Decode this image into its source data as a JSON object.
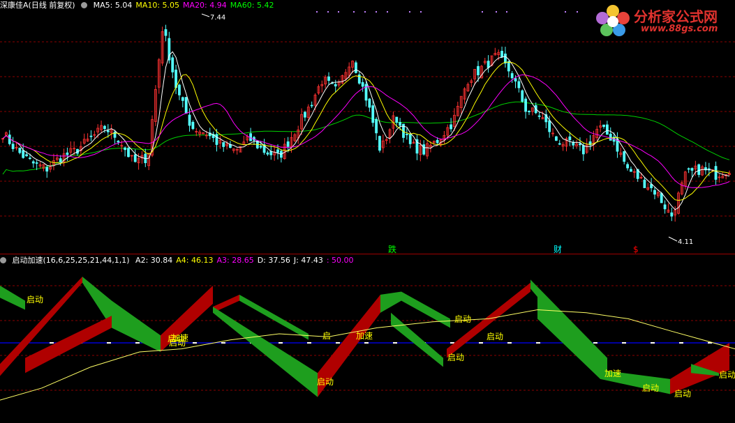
{
  "header_main": {
    "title": "深康佳A(日线 前复权)",
    "indicators": [
      {
        "label": "MA5: 5.04",
        "color": "#ffffff"
      },
      {
        "label": "MA10: 5.05",
        "color": "#ffff00"
      },
      {
        "label": "MA20: 4.94",
        "color": "#ff00ff"
      },
      {
        "label": "MA60: 5.42",
        "color": "#00ff00"
      }
    ]
  },
  "header_sub": {
    "title": "启动加速(16,6,25,25,21,44,1,1)",
    "indicators": [
      {
        "label": "A2: 30.84",
        "color": "#ffffff"
      },
      {
        "label": "A4: 46.13",
        "color": "#ffff00"
      },
      {
        "label": "A3: 28.65",
        "color": "#ff00ff"
      },
      {
        "label": "D: 37.56",
        "color": "#ffffff"
      },
      {
        "label": "J: 47.43",
        "color": "#ffffff"
      },
      {
        "label": ": 50.00",
        "color": "#ff00ff"
      }
    ]
  },
  "logo": {
    "title": "分析家公式网",
    "url": "www.88gs.com"
  },
  "colors": {
    "up": "#ff3232",
    "down": "#54ffff",
    "ma5": "#ffffff",
    "ma10": "#ffff00",
    "ma20": "#ff00ff",
    "ma60": "#00d000",
    "grid": "#8b0000",
    "ribbon_red": "#b00000",
    "ribbon_green": "#1e9e1e",
    "signal_line": "#ffff66",
    "baseline": "#0000ff"
  },
  "chart_data": [
    {
      "type": "candlestick",
      "price_range": [
        3.8,
        7.6
      ],
      "annotations": [
        {
          "text": "7.44",
          "kind": "high"
        },
        {
          "text": "4.11",
          "kind": "low"
        }
      ],
      "event_markers": [
        {
          "text": "跌",
          "color": "#00ff00"
        },
        {
          "text": "财",
          "color": "#00ffff"
        },
        {
          "text": "$",
          "color": "#ff0000"
        }
      ],
      "key_prices": [
        5.6,
        5.3,
        5.1,
        5.0,
        5.2,
        5.3,
        5.5,
        5.7,
        5.5,
        5.1,
        5.2,
        7.4,
        6.3,
        5.7,
        5.6,
        5.4,
        5.3,
        5.5,
        5.3,
        5.2,
        5.6,
        6.0,
        6.5,
        6.3,
        6.9,
        6.2,
        5.3,
        5.9,
        5.4,
        5.3,
        5.5,
        5.8,
        6.5,
        6.7,
        6.9,
        6.6,
        6.0,
        5.9,
        5.5,
        5.4,
        5.3,
        5.7,
        5.5,
        5.0,
        4.8,
        4.6,
        4.2,
        4.9,
        5.0,
        4.9,
        5.0
      ]
    },
    {
      "type": "area",
      "name": "启动加速",
      "range": [
        0,
        100
      ],
      "labels": [
        {
          "text": "启动",
          "color": "#ffff00"
        },
        {
          "text": "启动",
          "color": "#ffff00"
        },
        {
          "text": "加速",
          "color": "#ffff00"
        },
        {
          "text": "启",
          "color": "#ffff00"
        },
        {
          "text": "加速",
          "color": "#ffff00"
        },
        {
          "text": "启动",
          "color": "#ffff00"
        },
        {
          "text": "启动",
          "color": "#ffff00"
        },
        {
          "text": "启动",
          "color": "#ffff00"
        },
        {
          "text": "启动",
          "color": "#ffff00"
        },
        {
          "text": "加速",
          "color": "#ffff00"
        },
        {
          "text": "启动",
          "color": "#ffff00"
        },
        {
          "text": "启动",
          "color": "#ffff00"
        },
        {
          "text": "启动",
          "color": "#ffff00"
        },
        {
          "text": "启动",
          "color": "#ffff00"
        }
      ],
      "baseline_value": 50.0
    }
  ]
}
